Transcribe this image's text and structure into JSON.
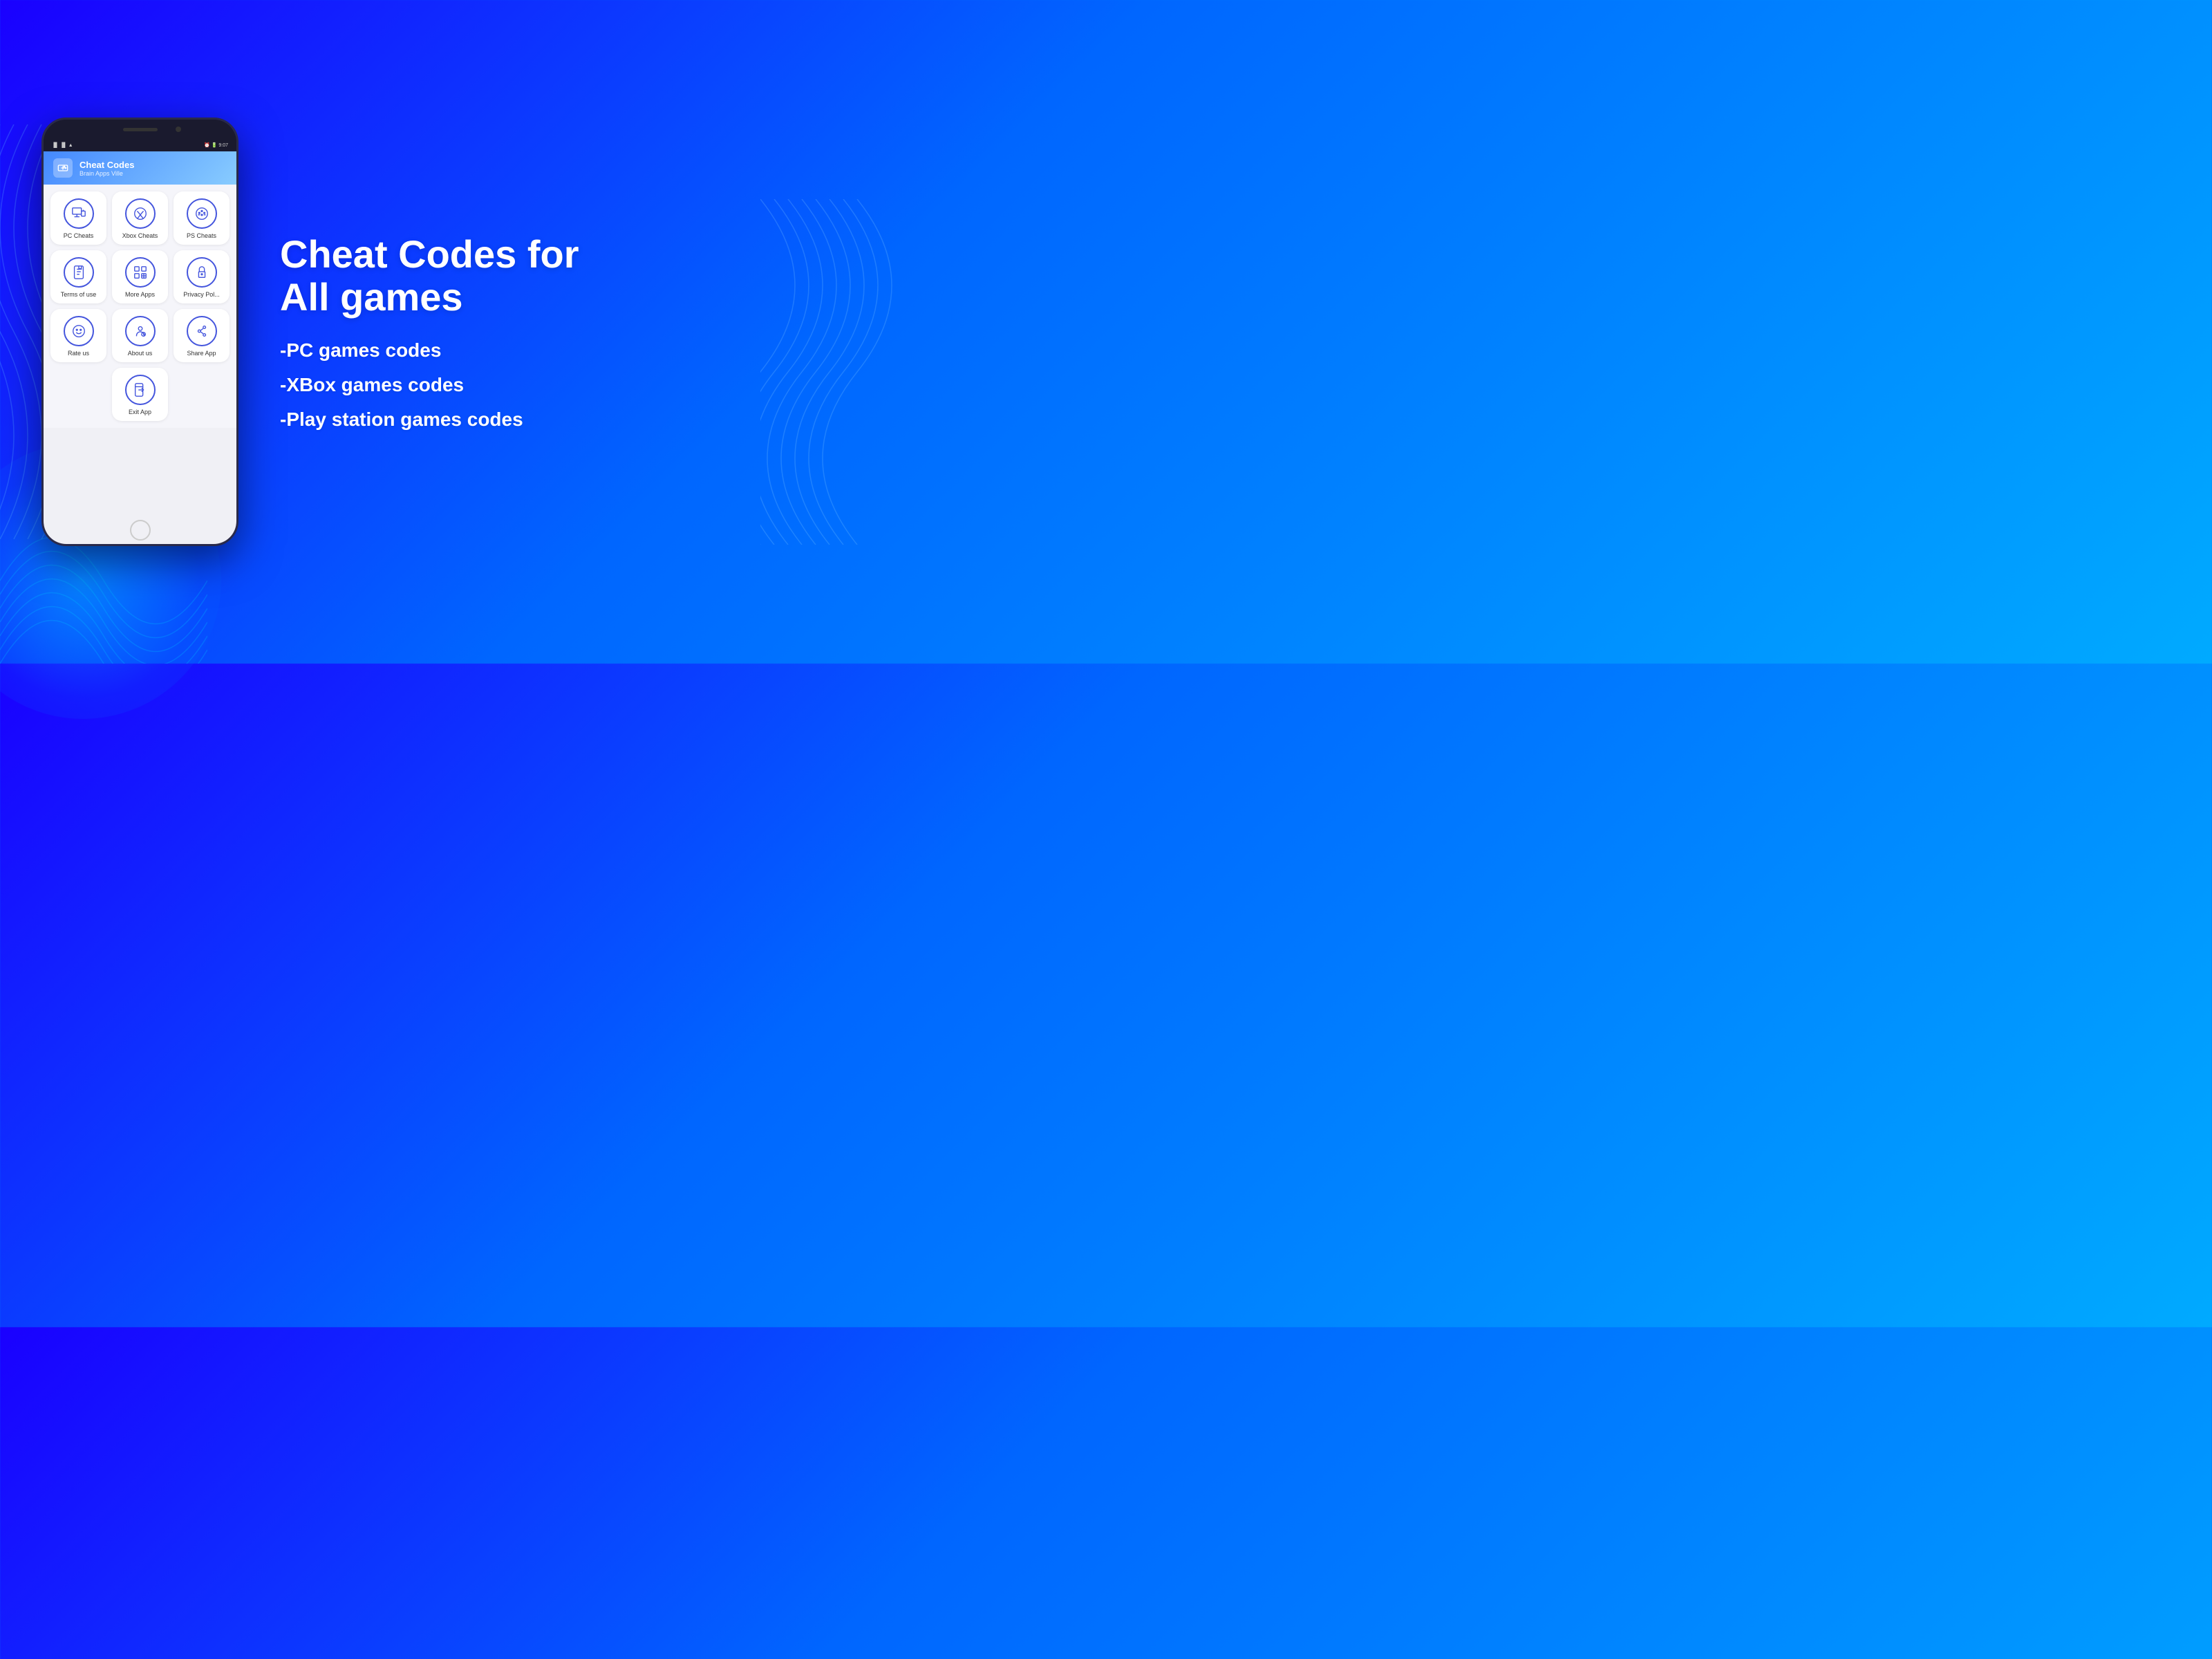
{
  "background": {
    "gradient_start": "#1a00ff",
    "gradient_end": "#00aaff"
  },
  "phone": {
    "status_left": "📶 📶",
    "status_right": "🔋",
    "app_header": {
      "title": "Cheat Codes",
      "subtitle": "Brain Apps Ville",
      "icon": "🎮"
    },
    "grid_items": [
      {
        "label": "PC Cheats",
        "icon_name": "pc-icon"
      },
      {
        "label": "Xbox Cheats",
        "icon_name": "xbox-icon"
      },
      {
        "label": "PS Cheats",
        "icon_name": "ps-icon"
      },
      {
        "label": "Terms of use",
        "icon_name": "terms-icon"
      },
      {
        "label": "More Apps",
        "icon_name": "more-apps-icon"
      },
      {
        "label": "Privacy Pol...",
        "icon_name": "privacy-icon"
      },
      {
        "label": "Rate us",
        "icon_name": "rate-icon"
      },
      {
        "label": "About us",
        "icon_name": "about-icon"
      },
      {
        "label": "Share App",
        "icon_name": "share-icon"
      },
      {
        "label": "Exit App",
        "icon_name": "exit-icon"
      }
    ]
  },
  "headline": {
    "line1": "Cheat Codes for",
    "line2": "All games"
  },
  "features": [
    "-PC games codes",
    "-XBox games codes",
    "-Play station games codes"
  ]
}
